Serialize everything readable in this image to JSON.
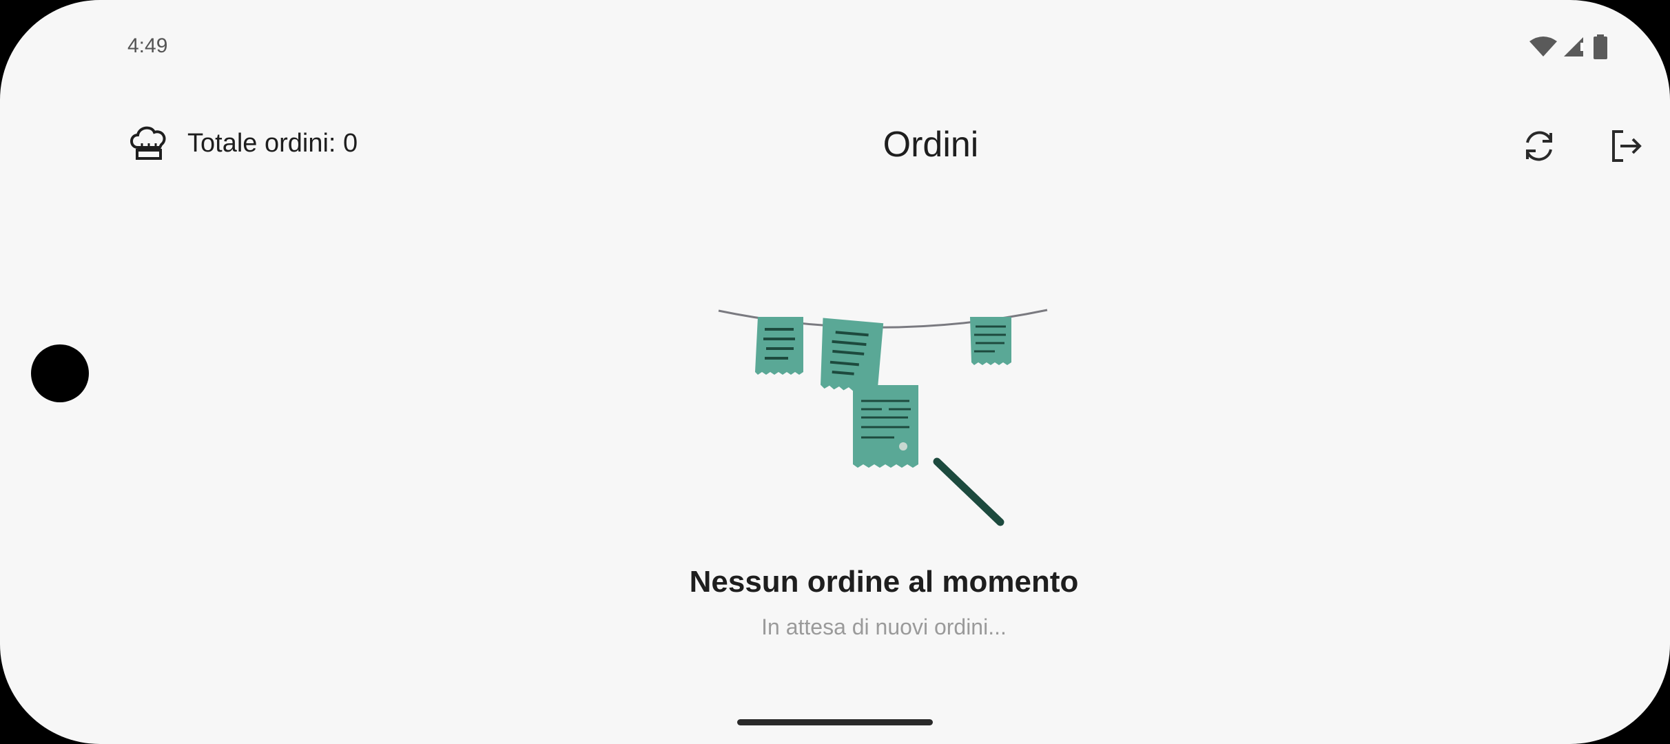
{
  "status_bar": {
    "time": "4:49",
    "icons": [
      "wifi-icon",
      "signal-icon",
      "battery-icon"
    ]
  },
  "header": {
    "chef_icon": "chef-hat-icon",
    "total_orders": "Totale ordini: 0",
    "title": "Ordini",
    "refresh_icon": "refresh-icon",
    "logout_icon": "logout-icon"
  },
  "empty_state": {
    "title": "Nessun ordine al momento",
    "subtitle": "In attesa di nuovi ordini..."
  },
  "colors": {
    "accent": "#5aa896",
    "dark_accent": "#1d4a3e",
    "text": "#1e1e1e",
    "muted": "#9a9a9a"
  }
}
